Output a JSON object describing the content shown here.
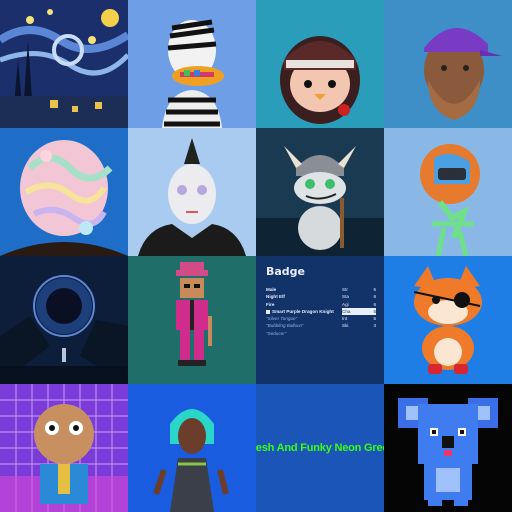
{
  "tiles": [
    {
      "name": "starry-night-pixel"
    },
    {
      "name": "zebra-duck"
    },
    {
      "name": "penguin-hood"
    },
    {
      "name": "bearded-man-purple-cap"
    },
    {
      "name": "pastel-slime-head"
    },
    {
      "name": "mohawk-avatar"
    },
    {
      "name": "viking-dragon"
    },
    {
      "name": "skeleton-helmet"
    },
    {
      "name": "portal-landscape"
    },
    {
      "name": "pixel-rat-suit"
    },
    {
      "name": "badge-card"
    },
    {
      "name": "pirate-fox"
    },
    {
      "name": "retro-grid-cartoon"
    },
    {
      "name": "cyber-woman"
    },
    {
      "name": "neon-green-text"
    },
    {
      "name": "pixel-koala"
    }
  ],
  "badge": {
    "title": "Badge",
    "traits": [
      "Male",
      "Night Elf",
      "Fire",
      "Smart Purple Dragon Knight",
      "\"Silver Tongue\"",
      "\"Bubbling Balloon\"",
      "\"Seducer\""
    ],
    "stats": [
      {
        "label": "Str",
        "value": "5"
      },
      {
        "label": "Sta",
        "value": "6"
      },
      {
        "label": "Agi",
        "value": "6"
      },
      {
        "label": "Cha",
        "value": "5"
      },
      {
        "label": "Int",
        "value": "5"
      },
      {
        "label": "Ski",
        "value": "3"
      }
    ]
  },
  "neon_text": "Fresh And Funky Neon Green",
  "colors": {
    "neon": "#39ff14",
    "badge_bg": "#12326a",
    "tile_blue": "#1c55b8"
  }
}
